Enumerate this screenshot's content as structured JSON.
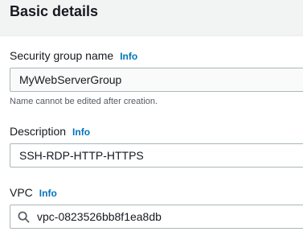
{
  "section": {
    "title": "Basic details"
  },
  "security_group_name": {
    "label": "Security group name",
    "info": "Info",
    "value": "MyWebServerGroup",
    "hint": "Name cannot be edited after creation."
  },
  "description": {
    "label": "Description",
    "info": "Info",
    "value": "SSH-RDP-HTTP-HTTPS"
  },
  "vpc": {
    "label": "VPC",
    "info": "Info",
    "value": "vpc-0823526bb8f1ea8db",
    "icon": "search-icon"
  }
}
